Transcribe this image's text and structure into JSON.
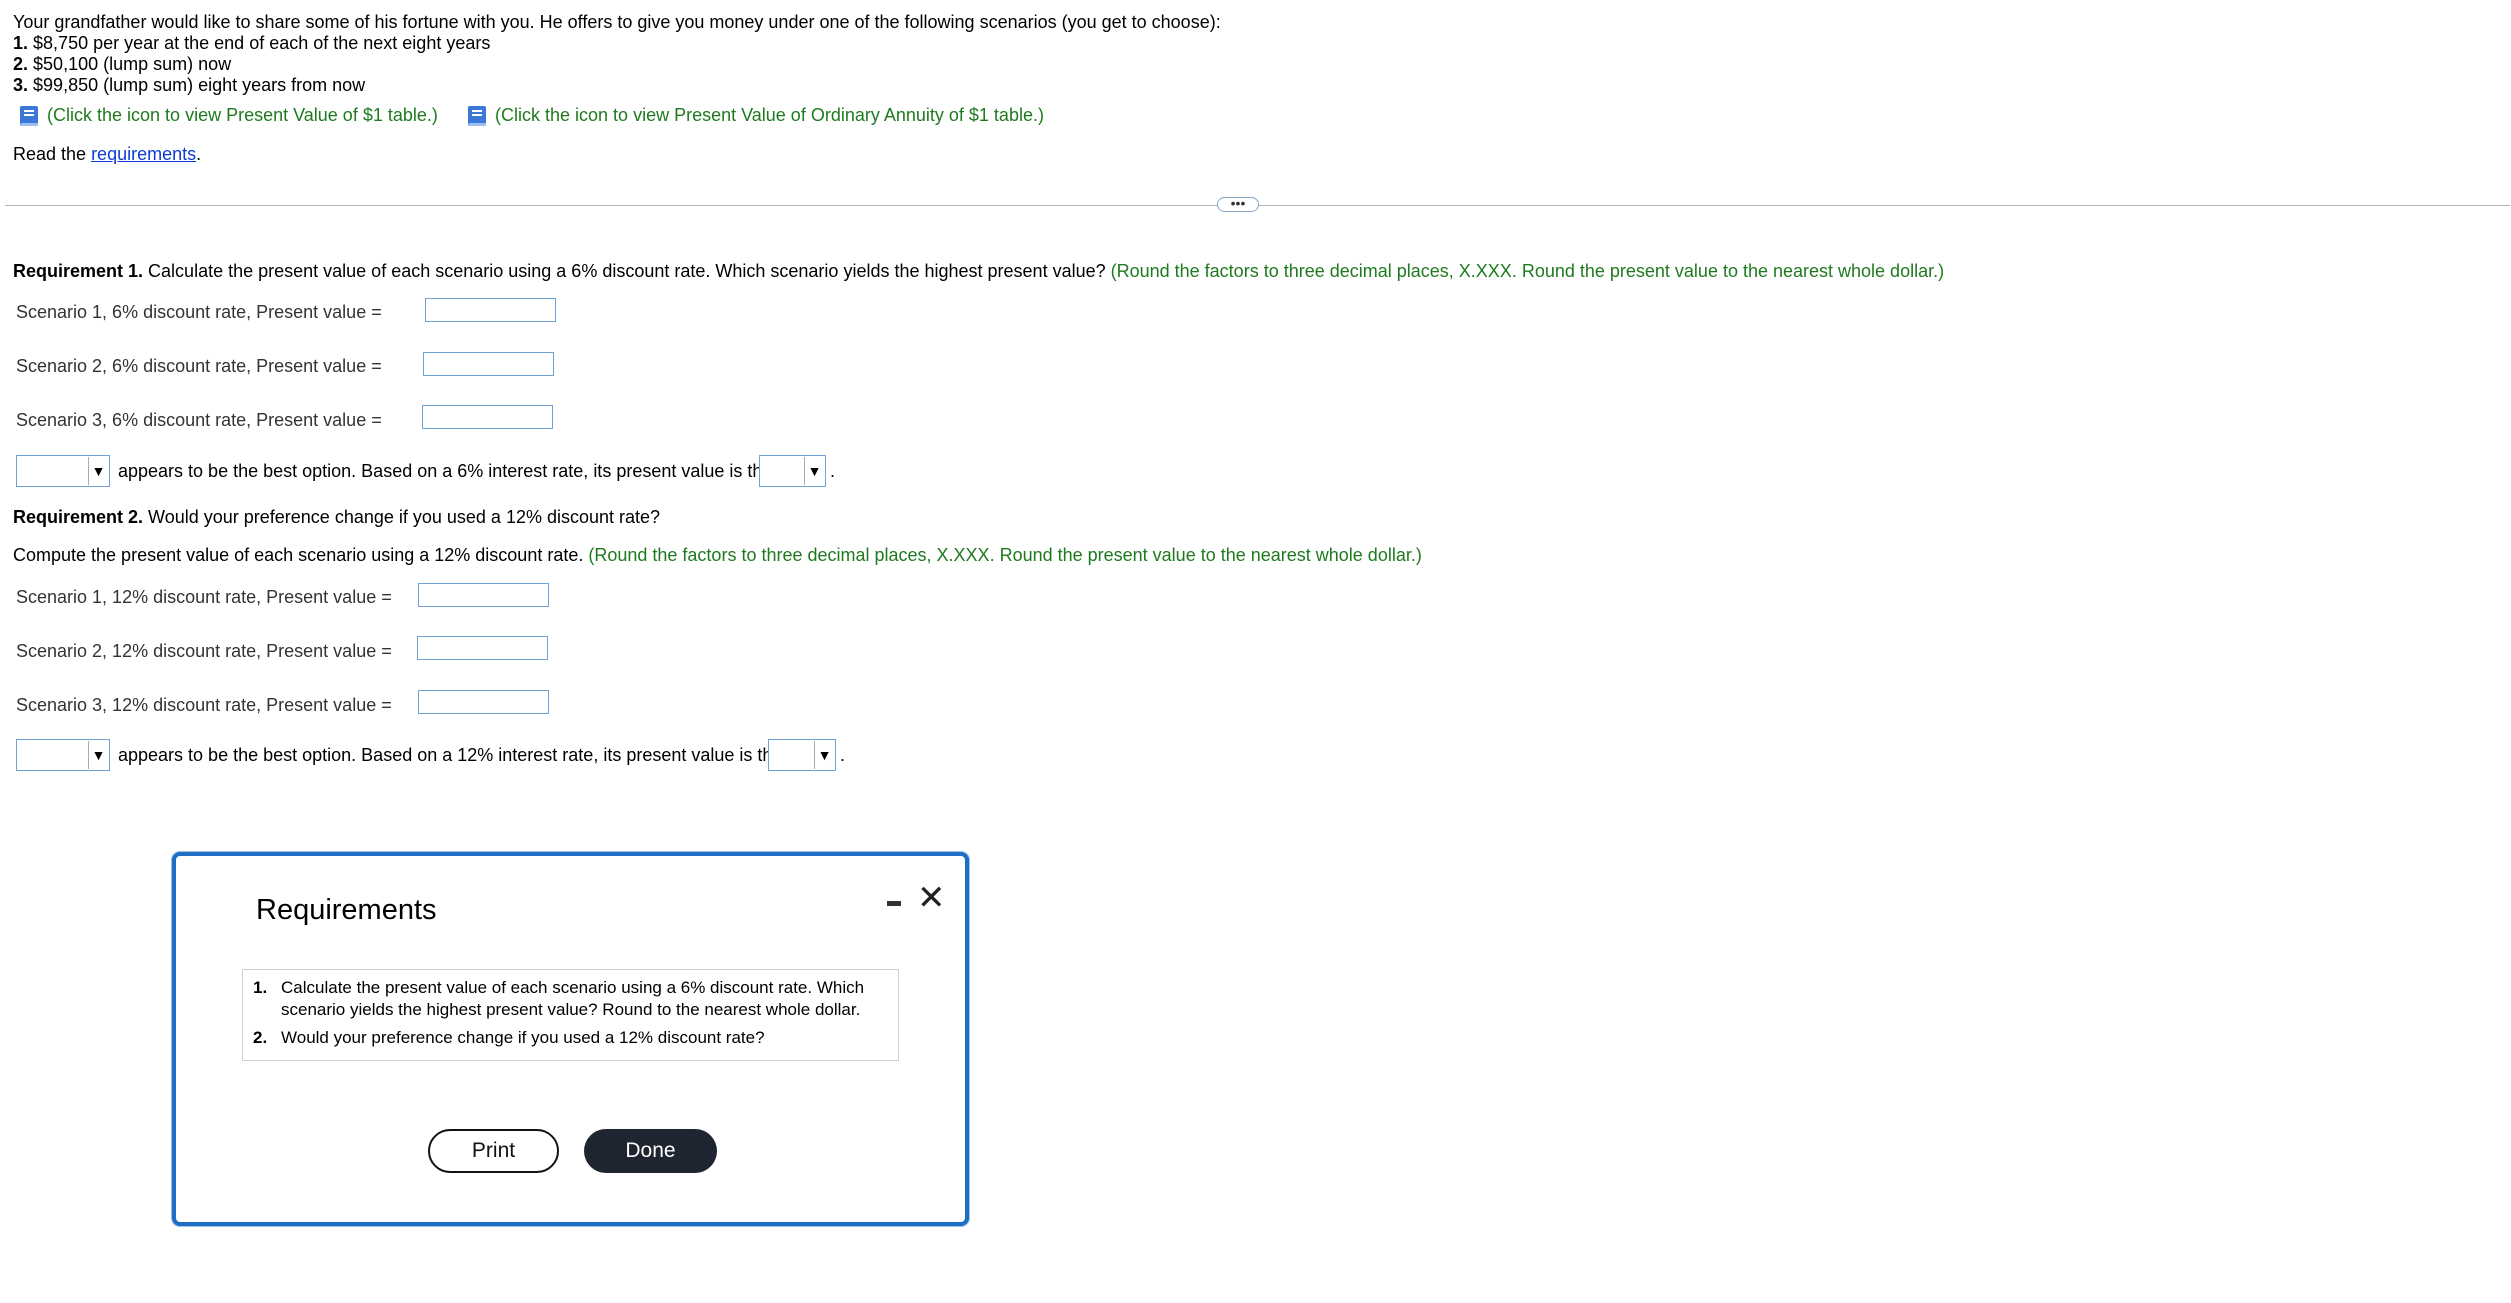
{
  "problem": {
    "intro": "Your grandfather would like to share some of his fortune with you. He offers to give you money under one of the following scenarios (you get to choose):",
    "scenarios": [
      {
        "num": "1.",
        "text": "$8,750 per year at the end of each of the next eight years"
      },
      {
        "num": "2.",
        "text": "$50,100 (lump sum) now"
      },
      {
        "num": "3.",
        "text": "$99,850 (lump sum) eight years from now"
      }
    ],
    "table_links": [
      {
        "text": "(Click the icon to view Present Value of $1 table.)",
        "icon": "book-icon"
      },
      {
        "text": "(Click the icon to view Present Value of Ordinary Annuity of $1 table.)",
        "icon": "book-icon"
      }
    ],
    "read_prefix": "Read the ",
    "read_link": "requirements",
    "read_suffix": "."
  },
  "more_button": "•••",
  "req1": {
    "label": "Requirement 1.",
    "text": " Calculate the present value of each scenario using a 6% discount rate. Which scenario yields the highest present value?",
    "hint": " (Round the factors to three decimal places, X.XXX. Round the present value to the nearest whole dollar.)",
    "rows": [
      {
        "label": "Scenario 1, 6% discount rate, Present value =",
        "value": ""
      },
      {
        "label": "Scenario 2, 6% discount rate, Present value =",
        "value": ""
      },
      {
        "label": "Scenario 3, 6% discount rate, Present value =",
        "value": ""
      }
    ],
    "best_mid": "appears to be the best option. Based on a 6% interest rate, its present value is the",
    "best_end": "."
  },
  "req2": {
    "label": "Requirement 2.",
    "text": " Would your preference change if you used a 12% discount rate?",
    "compute": "Compute the present value of each scenario using a 12% discount rate.",
    "hint": " (Round the factors to three decimal places, X.XXX. Round the present value to the nearest whole dollar.)",
    "rows": [
      {
        "label": "Scenario 1, 12% discount rate, Present value =",
        "value": ""
      },
      {
        "label": "Scenario 2, 12% discount rate, Present value =",
        "value": ""
      },
      {
        "label": "Scenario 3, 12% discount rate, Present value =",
        "value": ""
      }
    ],
    "best_mid": "appears to be the best option. Based on a 12% interest rate, its present value is the",
    "best_end": "."
  },
  "dialog": {
    "title": "Requirements",
    "items": [
      {
        "num": "1.",
        "text": "Calculate the present value of each scenario using a 6% discount rate. Which scenario yields the highest present value? Round to the nearest whole dollar."
      },
      {
        "num": "2.",
        "text": "Would your preference change if you used a 12% discount rate?"
      }
    ],
    "print_label": "Print",
    "done_label": "Done",
    "accent_color": "#1e6fc4"
  },
  "dropdown_arrow": "▼",
  "close_glyph": "✕"
}
